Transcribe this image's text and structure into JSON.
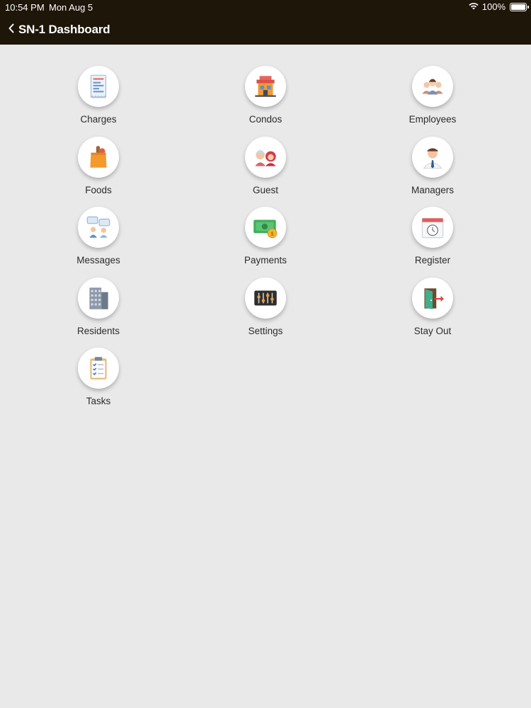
{
  "status_bar": {
    "time": "10:54 PM",
    "date": "Mon Aug 5",
    "battery": "100%"
  },
  "nav": {
    "back_icon": "chevron-left-icon",
    "title": "SN-1 Dashboard"
  },
  "tiles": [
    {
      "label": "Charges",
      "icon": "receipt-icon"
    },
    {
      "label": "Condos",
      "icon": "building-storefront-icon"
    },
    {
      "label": "Employees",
      "icon": "group-people-icon"
    },
    {
      "label": "Foods",
      "icon": "grocery-bag-icon"
    },
    {
      "label": "Guest",
      "icon": "guests-icon"
    },
    {
      "label": "Managers",
      "icon": "manager-icon"
    },
    {
      "label": "Messages",
      "icon": "chat-people-icon"
    },
    {
      "label": "Payments",
      "icon": "cash-money-icon"
    },
    {
      "label": "Register",
      "icon": "calendar-clock-icon"
    },
    {
      "label": "Residents",
      "icon": "apartment-tower-icon"
    },
    {
      "label": "Settings",
      "icon": "sliders-icon"
    },
    {
      "label": "Stay Out",
      "icon": "exit-door-icon"
    },
    {
      "label": "Tasks",
      "icon": "clipboard-checklist-icon"
    }
  ],
  "colors": {
    "topbar": "#1e1608",
    "background": "#e9e9e9",
    "tile_circle": "#ffffff"
  }
}
